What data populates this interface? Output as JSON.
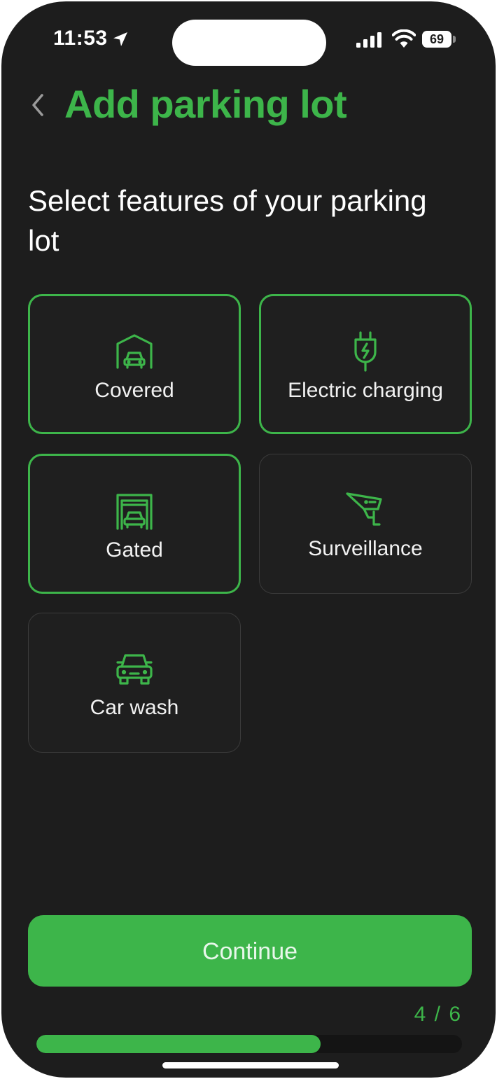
{
  "status_bar": {
    "time": "11:53",
    "battery_level": "69"
  },
  "header": {
    "back_icon": "chevron-left-icon",
    "title": "Add parking lot"
  },
  "question": "Select features of your parking lot",
  "features": [
    {
      "label": "Covered",
      "icon": "covered-garage-icon",
      "selected": true
    },
    {
      "label": "Electric charging",
      "icon": "ev-plug-icon",
      "selected": true
    },
    {
      "label": "Gated",
      "icon": "gated-garage-icon",
      "selected": true
    },
    {
      "label": "Surveillance",
      "icon": "security-camera-icon",
      "selected": false
    },
    {
      "label": "Car wash",
      "icon": "car-icon",
      "selected": false
    }
  ],
  "continue_label": "Continue",
  "progress": {
    "label": "4 / 6",
    "fraction": 0.667
  },
  "colors": {
    "accent": "#3db54a",
    "background": "#1d1d1d",
    "card_background": "#1f1f1f",
    "card_border_unselected": "#3b3b3b",
    "text": "#ffffff"
  }
}
